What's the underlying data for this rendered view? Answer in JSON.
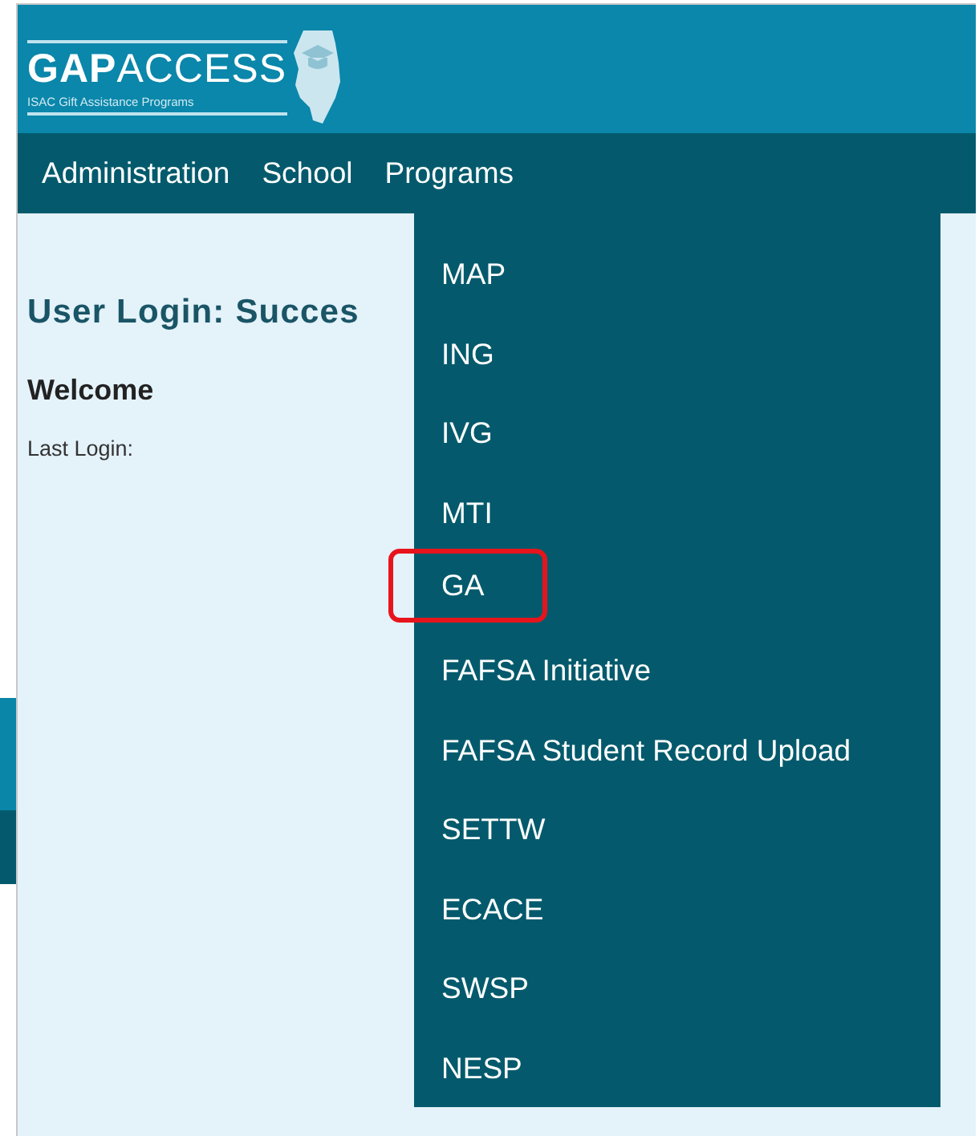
{
  "logo": {
    "wordmark": "**GAP**ACCESS",
    "tagline": "ISAC Gift Assistance Programs"
  },
  "nav": [
    {
      "label": "Administration"
    },
    {
      "label": "School"
    },
    {
      "label": "Programs"
    }
  ],
  "dropdown": [
    {
      "label": "MAP",
      "highlighted": false
    },
    {
      "label": "ING",
      "highlighted": false
    },
    {
      "label": "IVG",
      "highlighted": false
    },
    {
      "label": "MTI",
      "highlighted": false
    },
    {
      "label": "GA",
      "highlighted": true
    },
    {
      "label": "FAFSA Initiative",
      "highlighted": false
    },
    {
      "label": "FAFSA Student Record Upload",
      "highlighted": false
    },
    {
      "label": "SETTW",
      "highlighted": false
    },
    {
      "label": "ECACE",
      "highlighted": false
    },
    {
      "label": "SWSP",
      "highlighted": false
    },
    {
      "label": "NESP",
      "highlighted": false
    }
  ],
  "content": {
    "title": "User Login: Succes",
    "welcome": "Welcome",
    "last_login_label": "Last Login:"
  }
}
